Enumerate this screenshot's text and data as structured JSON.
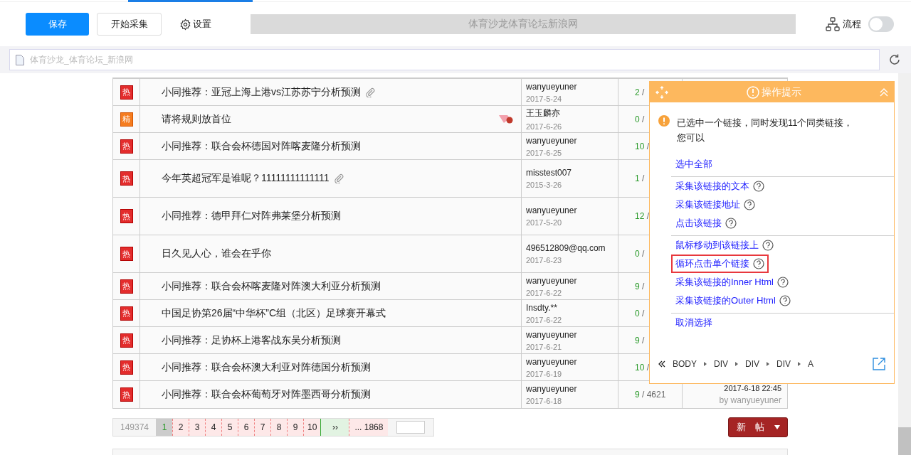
{
  "toolbar": {
    "save": "保存",
    "start": "开始采集",
    "settings": "设置",
    "page_title": "体育沙龙体育论坛新浪网",
    "flow": {
      "label": "流程",
      "on": false
    }
  },
  "address": {
    "value": "体育沙龙_体育论坛_新浪网"
  },
  "table": {
    "rows": [
      {
        "badge": "热",
        "kind": "hot",
        "title": "小同推荐：亚冠上海上港vs江苏苏宁分析预测",
        "attachment": true,
        "gem": false,
        "tall": false,
        "author": "wanyueyuner",
        "date": "2017-5-24",
        "replies": "2 /"
      },
      {
        "badge": "精",
        "kind": "best",
        "title": "请将规则放首位",
        "attachment": false,
        "gem": true,
        "tall": false,
        "author": "王玉麟亦",
        "date": "2017-6-26",
        "replies": "0 /"
      },
      {
        "badge": "热",
        "kind": "hot",
        "title": "小同推荐：联合会杯德国对阵喀麦隆分析预测",
        "attachment": false,
        "gem": false,
        "tall": false,
        "author": "wanyueyuner",
        "date": "2017-6-25",
        "replies": "10 /"
      },
      {
        "badge": "热",
        "kind": "hot",
        "title": "今年英超冠军是谁呢？11111111111111",
        "attachment": true,
        "gem": false,
        "tall": true,
        "author": "misstest007",
        "date": "2015-3-26",
        "replies": "1 /"
      },
      {
        "badge": "热",
        "kind": "hot",
        "title": "小同推荐：德甲拜仁对阵弗莱堡分析预测",
        "attachment": false,
        "gem": false,
        "tall": true,
        "author": "wanyueyuner",
        "date": "2017-5-20",
        "replies": "12 /"
      },
      {
        "badge": "热",
        "kind": "hot",
        "title": "日久见人心，谁会在乎你",
        "attachment": false,
        "gem": false,
        "tall": true,
        "author": "496512809@qq.com",
        "date": "2017-6-23",
        "replies": "0 /"
      },
      {
        "badge": "热",
        "kind": "hot",
        "title": "小同推荐：联合会杯喀麦隆对阵澳大利亚分析预测",
        "attachment": false,
        "gem": false,
        "tall": false,
        "author": "wanyueyuner",
        "date": "2017-6-22",
        "replies": "9 /"
      },
      {
        "badge": "热",
        "kind": "hot",
        "title": "中国足协第26届“中华杯”C组（北区）足球赛开幕式",
        "attachment": false,
        "gem": false,
        "tall": false,
        "author": "Insdty.**",
        "date": "2017-6-22",
        "replies": "0 /"
      },
      {
        "badge": "热",
        "kind": "hot",
        "title": "小同推荐：足协杯上港客战东吴分析预测",
        "attachment": false,
        "gem": false,
        "tall": false,
        "author": "wanyueyuner",
        "date": "2017-6-21",
        "replies": "9 /"
      },
      {
        "badge": "热",
        "kind": "hot",
        "title": "小同推荐：联合会杯澳大利亚对阵德国分析预测",
        "attachment": false,
        "gem": false,
        "tall": false,
        "author": "wanyueyuner",
        "date": "2017-6-19",
        "replies": "10 /"
      },
      {
        "badge": "热",
        "kind": "hot",
        "title": "小同推荐：联合会杯葡萄牙对阵墨西哥分析预测",
        "attachment": false,
        "gem": false,
        "tall": false,
        "author": "wanyueyuner",
        "date": "2017-6-18",
        "replies": "9 / 4621",
        "last_time": "2017-6-18 22:45",
        "last_by": "by wanyueyuner"
      }
    ]
  },
  "pagination": {
    "total": "149374",
    "pages": [
      {
        "label": "1",
        "selected": true
      },
      {
        "label": "2",
        "selected": false
      },
      {
        "label": "3",
        "selected": false
      },
      {
        "label": "4",
        "selected": false
      },
      {
        "label": "5",
        "selected": false
      },
      {
        "label": "6",
        "selected": false
      },
      {
        "label": "7",
        "selected": false
      },
      {
        "label": "8",
        "selected": false
      },
      {
        "label": "9",
        "selected": false
      },
      {
        "label": "10",
        "selected": false
      }
    ],
    "next": "››",
    "last": "... 1868"
  },
  "new_post": "新　帖",
  "tips": {
    "title": "操作提示",
    "message": "已选中一个链接，同时发现11个同类链接，您可以",
    "groups": [
      [
        {
          "label": "选中全部",
          "help": false,
          "highlighted": false
        }
      ],
      [
        {
          "label": "采集该链接的文本",
          "help": true,
          "highlighted": false
        },
        {
          "label": "采集该链接地址",
          "help": true,
          "highlighted": false
        },
        {
          "label": "点击该链接",
          "help": true,
          "highlighted": false
        }
      ],
      [
        {
          "label": "鼠标移动到该链接上",
          "help": true,
          "highlighted": false
        },
        {
          "label": "循环点击单个链接",
          "help": true,
          "highlighted": true
        },
        {
          "label": "采集该链接的Inner Html",
          "help": true,
          "highlighted": false
        },
        {
          "label": "采集该链接的Outer Html",
          "help": true,
          "highlighted": false
        }
      ],
      [
        {
          "label": "取消选择",
          "help": false,
          "highlighted": false
        }
      ]
    ],
    "path": [
      "BODY",
      "DIV",
      "DIV",
      "DIV",
      "A"
    ]
  }
}
